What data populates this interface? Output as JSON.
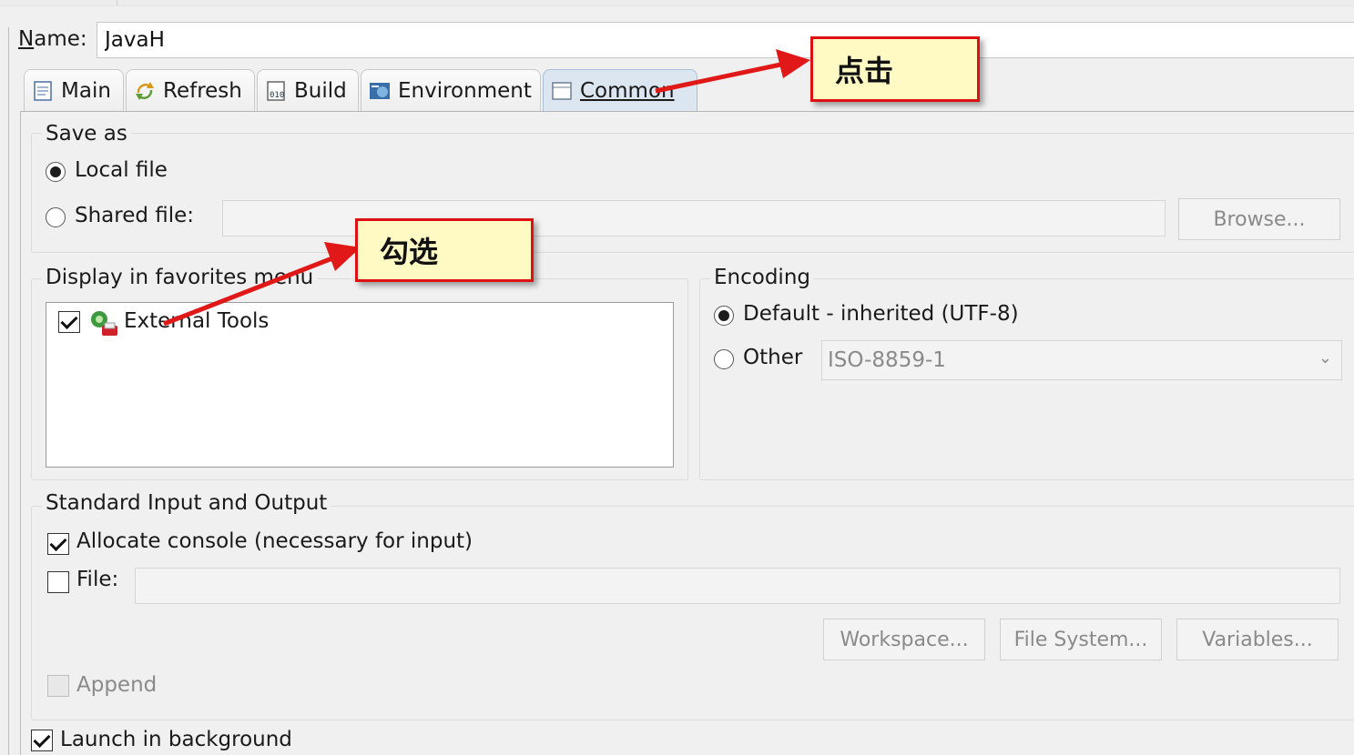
{
  "name_field": {
    "label": "Name:",
    "value": "JavaH"
  },
  "tabs": [
    {
      "label": "Main",
      "icon": "main-tab-icon"
    },
    {
      "label": "Refresh",
      "icon": "refresh-tab-icon"
    },
    {
      "label": "Build",
      "icon": "build-tab-icon"
    },
    {
      "label": "Environment",
      "icon": "environment-tab-icon"
    },
    {
      "label": "Common",
      "icon": "common-tab-icon",
      "active": true
    }
  ],
  "save_as": {
    "title": "Save as",
    "local_label": "Local file",
    "shared_label": "Shared file:",
    "browse_label": "Browse...",
    "selected": "local"
  },
  "favorites": {
    "title": "Display in favorites menu",
    "items": [
      {
        "label": "External Tools",
        "checked": true
      }
    ]
  },
  "encoding": {
    "title": "Encoding",
    "default_label": "Default - inherited (UTF-8)",
    "other_label": "Other",
    "other_value": "ISO-8859-1",
    "selected": "default"
  },
  "std_io": {
    "title": "Standard Input and Output",
    "allocate_label": "Allocate console (necessary for input)",
    "allocate_checked": true,
    "file_label": "File:",
    "file_checked": false,
    "workspace_label": "Workspace...",
    "filesystem_label": "File System...",
    "variables_label": "Variables...",
    "append_label": "Append"
  },
  "launch_bg": {
    "label": "Launch in background",
    "checked": true
  },
  "annotations": {
    "click_text": "点击",
    "check_text": "勾选"
  },
  "colors": {
    "annotation_border": "#dd1111",
    "annotation_fill": "#fff9c4",
    "arrow": "#e01818",
    "active_tab": "#dbe6f1"
  }
}
